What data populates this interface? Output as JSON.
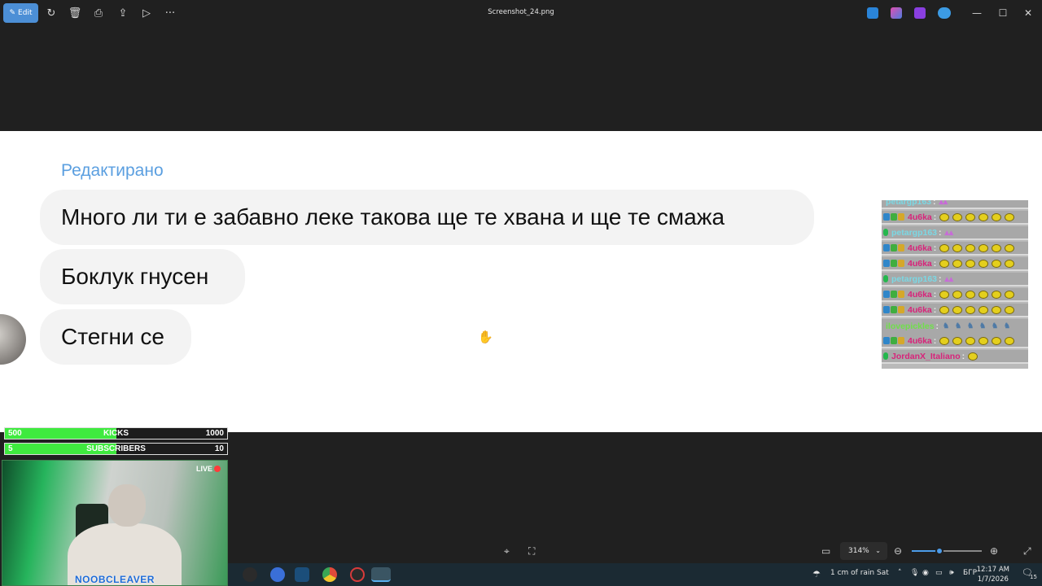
{
  "toolbar": {
    "edit_label": "Edit",
    "file_title": "Screenshot_24.png",
    "more_label": "···",
    "window_controls": {
      "minimize": "—",
      "maximize": "☐",
      "close": "✕"
    }
  },
  "message_thread": {
    "edited_label": "Редактирано",
    "messages": [
      "Много ли ти е забавно леке такова ще те хвана и ще те смажа",
      "Боклук гнусен",
      "Стегни се"
    ]
  },
  "stream_chat": {
    "rows": [
      {
        "user": "petargp163",
        "color": "#7ad8e4",
        "type": "text",
        "message": ""
      },
      {
        "user": "4u6ka",
        "color": "#d8247a",
        "type": "emotes",
        "badges": 3
      },
      {
        "user": "petargp163",
        "color": "#7ad8e4",
        "type": "text",
        "badges": 1
      },
      {
        "user": "4u6ka",
        "color": "#d8247a",
        "type": "emotes",
        "badges": 3
      },
      {
        "user": "4u6ka",
        "color": "#d8247a",
        "type": "emotes",
        "badges": 3
      },
      {
        "user": "petargp163",
        "color": "#7ad8e4",
        "type": "text",
        "badges": 1
      },
      {
        "user": "4u6ka",
        "color": "#d8247a",
        "type": "emotes",
        "badges": 3
      },
      {
        "user": "4u6ka",
        "color": "#d8247a",
        "type": "emotes",
        "badges": 3
      },
      {
        "user": "ilovepickles",
        "color": "#6fe04a",
        "type": "pepes",
        "badges": 0
      },
      {
        "user": "4u6ka",
        "color": "#d8247a",
        "type": "emotes",
        "badges": 3
      },
      {
        "user": "JordanX_Italiano",
        "color": "#d8247a",
        "type": "single",
        "badges": 1
      }
    ],
    "separator": ":"
  },
  "stream_overlay": {
    "kicks_bar": {
      "current": "500",
      "label": "KICKS",
      "goal": "1000",
      "progress": 0.5
    },
    "subs_bar": {
      "current": "5",
      "label": "SUBSCRIBERS",
      "goal": "10",
      "progress": 0.5
    },
    "live_label": "LIVE",
    "streamer_name": "NOOBCLEAVER"
  },
  "viewbar": {
    "zoom_level": "314%",
    "zoom_slider_value": 0.4
  },
  "taskbar": {
    "weather": "1 cm of rain Sat",
    "language": "БГР",
    "time": "12:17 AM",
    "date": "1/7/2026",
    "notification_count": "15"
  },
  "colors": {
    "accent": "#4c8fd6",
    "edited_label": "#5b9fe0",
    "bar_fill": "#3fea3f"
  }
}
